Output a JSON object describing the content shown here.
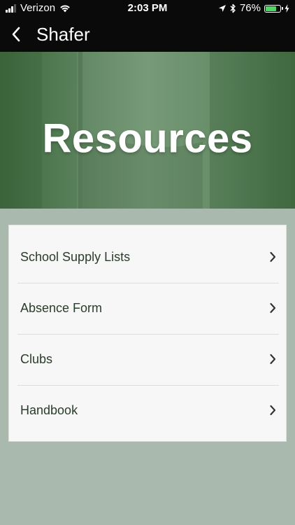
{
  "status_bar": {
    "carrier": "Verizon",
    "time": "2:03 PM",
    "battery_percent": "76%",
    "battery_level": 0.76,
    "icons": [
      "signal-icon",
      "wifi-icon",
      "location-arrow-icon",
      "bluetooth-icon",
      "battery-icon",
      "charging-icon"
    ]
  },
  "nav": {
    "back_icon": "chevron-left-icon",
    "title": "Shafer"
  },
  "banner": {
    "title": "Resources"
  },
  "menu": {
    "items": [
      {
        "label": "School Supply Lists",
        "icon": "chevron-right-icon"
      },
      {
        "label": "Absence Form",
        "icon": "chevron-right-icon"
      },
      {
        "label": "Clubs",
        "icon": "chevron-right-icon"
      },
      {
        "label": "Handbook",
        "icon": "chevron-right-icon"
      }
    ]
  },
  "colors": {
    "status_bar_bg": "#0a0a0a",
    "banner_green": "#587f59",
    "page_bg": "#a9b9ad",
    "card_bg": "#f7f7f7",
    "item_text": "#2a3d2a",
    "battery_fill": "#4cd964"
  }
}
